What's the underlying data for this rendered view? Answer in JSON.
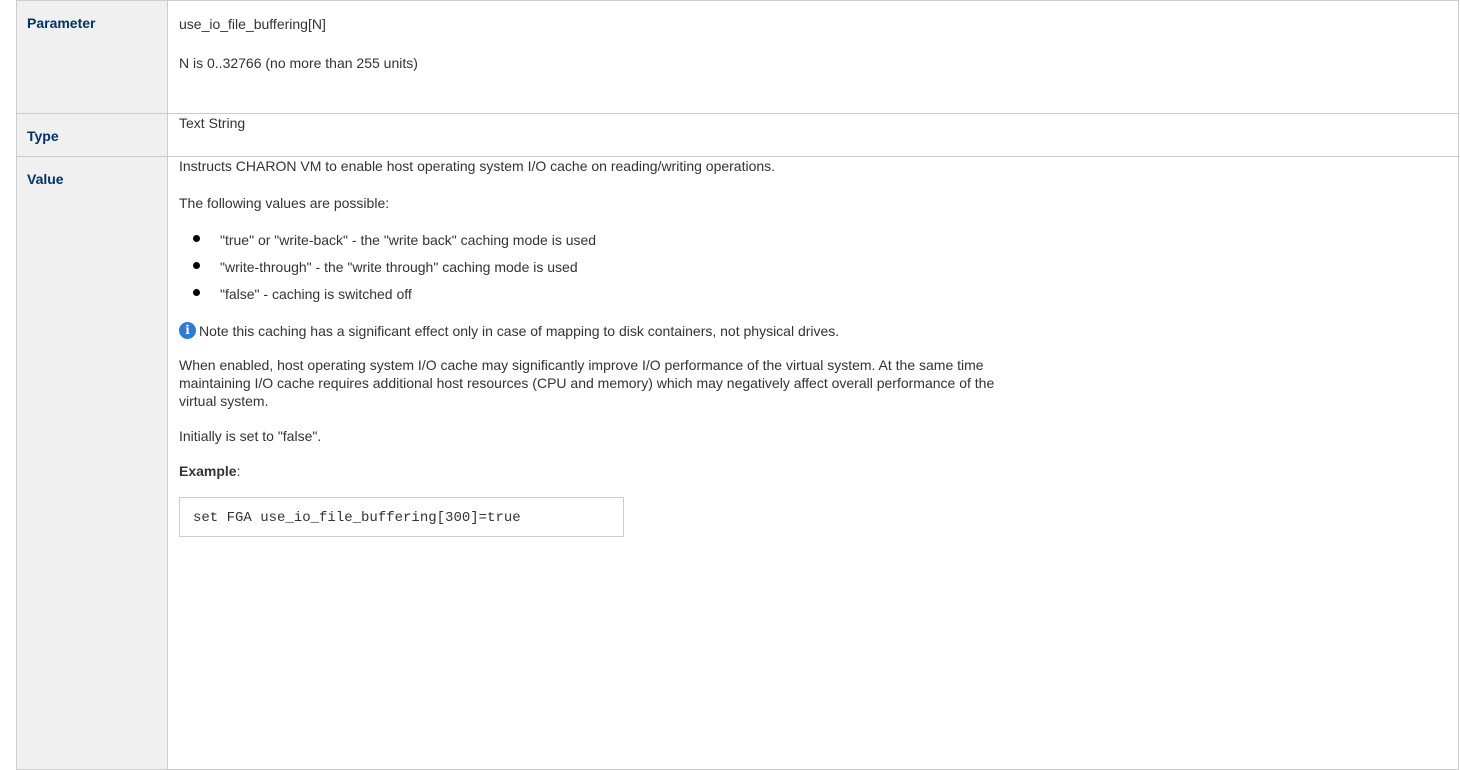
{
  "table": {
    "parameter": {
      "header": "Parameter",
      "name": "use_io_file_buffering[N]",
      "range": "N is 0..32766 (no more than 255 units)"
    },
    "type": {
      "header": "Type",
      "value": "Text String"
    },
    "value": {
      "header": "Value",
      "intro": "Instructs CHARON VM to enable host operating system I/O cache on reading/writing operations.",
      "possible": "The following values are possible:",
      "options": [
        "\"true\" or \"write-back\" - the \"write back\" caching mode is used",
        "\"write-through\" - the \"write through\" caching mode is used",
        "\"false\" - caching is switched off"
      ],
      "note_icon": "info-icon",
      "note": "Note this caching has a significant effect only in case of mapping to disk containers, not physical drives.",
      "description_lines": [
        "When enabled, host operating system I/O cache may significantly improve I/O performance of the virtual system. At the same time",
        "maintaining I/O cache requires additional host resources (CPU and memory) which may negatively affect overall performance of the",
        "virtual system."
      ],
      "initial": "Initially is set to \"false\".",
      "example_label": "Example",
      "example_colon": ":",
      "example_code": "set FGA use_io_file_buffering[300]=true"
    }
  },
  "colors": {
    "header_bg": "#f0f0f0",
    "header_text": "#003366",
    "border": "#cccccc",
    "info_icon": "#2f7ad3"
  }
}
